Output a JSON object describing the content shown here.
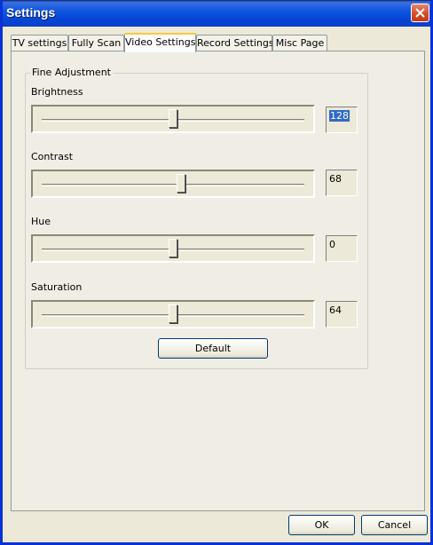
{
  "window": {
    "title": "Settings"
  },
  "tabs": [
    {
      "label": "TV settings"
    },
    {
      "label": "Fully Scan"
    },
    {
      "label": "Video Settings",
      "active": true
    },
    {
      "label": "Record Settings"
    },
    {
      "label": "Misc Page"
    }
  ],
  "fine_adjustment": {
    "legend": "Fine Adjustment",
    "brightness": {
      "label": "Brightness",
      "value": "128",
      "position": 0.5
    },
    "contrast": {
      "label": "Contrast",
      "value": "68",
      "position": 0.53
    },
    "hue": {
      "label": "Hue",
      "value": "0",
      "position": 0.5
    },
    "saturation": {
      "label": "Saturation",
      "value": "64",
      "position": 0.5
    },
    "default_label": "Default"
  },
  "footer": {
    "ok_label": "OK",
    "cancel_label": "Cancel"
  },
  "colors": {
    "titlebar": "#0b53e0",
    "selection": "#316ac5",
    "close": "#d24a26"
  }
}
